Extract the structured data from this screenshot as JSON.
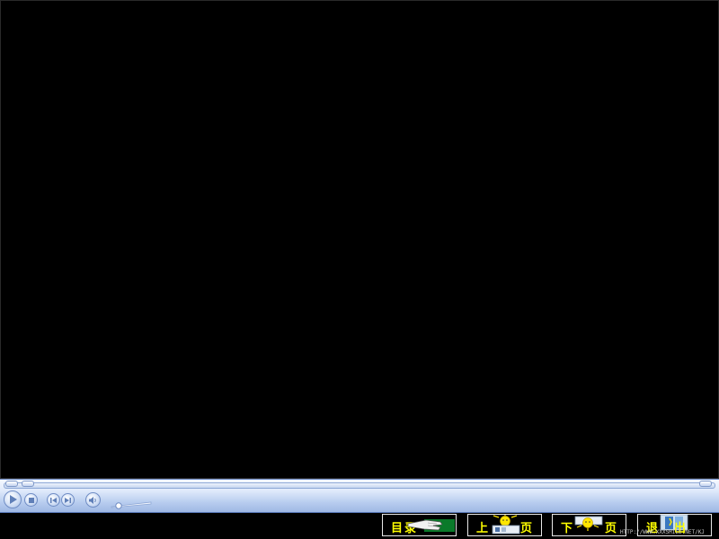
{
  "player": {
    "state": "stopped"
  },
  "nav": {
    "contents_label_1": "目",
    "contents_label_2": "录",
    "prev_label_1": "上",
    "prev_label_2": "页",
    "next_label_1": "下",
    "next_label_2": "页",
    "exit_label_1": "退",
    "exit_label_2": "出"
  },
  "footer": {
    "url": "HTTP://WWW.XXXSHILE.NET/KJ"
  },
  "colors": {
    "nav_text": "#ffff00",
    "player_accent": "#9fb8e4",
    "background": "#000000"
  }
}
